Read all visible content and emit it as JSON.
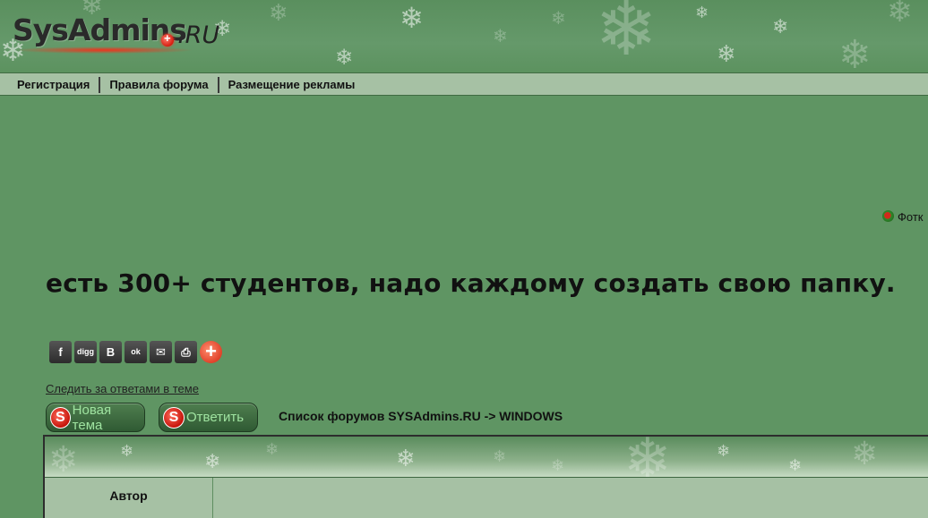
{
  "header": {
    "logo_text": "SysAdmins",
    "logo_suffix": ".RU"
  },
  "nav": {
    "items": [
      {
        "label": "Регистрация"
      },
      {
        "label": "Правила форума"
      },
      {
        "label": "Размещение рекламы"
      }
    ]
  },
  "side_link": {
    "label": "Фотк"
  },
  "topic": {
    "title": "есть 300+ студентов, надо каждому создать свою папку."
  },
  "share": {
    "icons": [
      "facebook-icon",
      "digg-icon",
      "vkontakte-icon",
      "odnoklassniki-icon",
      "email-icon",
      "print-icon",
      "more-icon"
    ],
    "labels": {
      "facebook": "f",
      "digg": "digg",
      "vk": "B",
      "ok": "ok",
      "mail": "✉",
      "print": "⎙",
      "more": "+"
    }
  },
  "follow_link": "Следить за ответами в теме",
  "actions": {
    "new_topic": "Новая тема",
    "reply": "Ответить",
    "badge": "S"
  },
  "breadcrumb": "Список форумов SYSAdmins.RU -> WINDOWS",
  "table": {
    "author_header": "Автор"
  },
  "colors": {
    "background": "#5f9563",
    "navbar": "#a6c1a4",
    "accent_red": "#d61c10"
  }
}
